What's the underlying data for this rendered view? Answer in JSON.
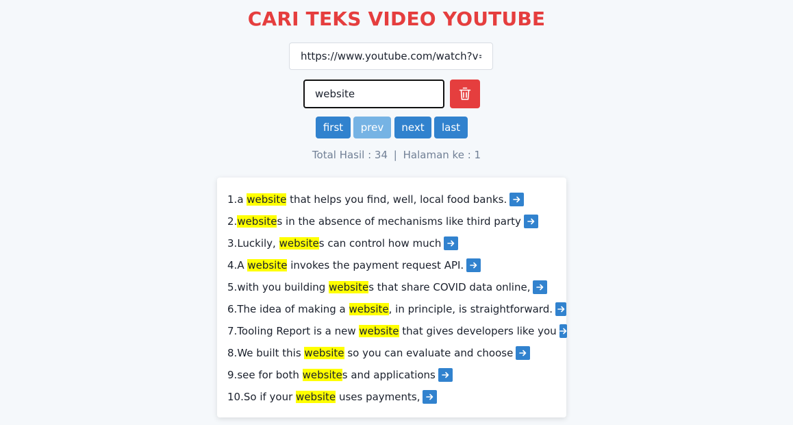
{
  "title": "CARI TEKS VIDEO YOUTUBE",
  "url_input": {
    "value": "https://www.youtube.com/watch?v=kl"
  },
  "keyword_input": {
    "value": "website"
  },
  "pagination": {
    "first": "first",
    "prev": "prev",
    "next": "next",
    "last": "last"
  },
  "status": {
    "total_text": "Total Hasil : 34",
    "separator": "|",
    "page_text": "Halaman ke : 1"
  },
  "results": [
    {
      "num": "1.",
      "before": "a ",
      "match": "website",
      "after": " that helps you find, well, local food banks."
    },
    {
      "num": "2.",
      "before": "",
      "match": "website",
      "after": "s in the absence of mechanisms like third party"
    },
    {
      "num": "3.",
      "before": "Luckily, ",
      "match": "website",
      "after": "s can control how much"
    },
    {
      "num": "4.",
      "before": "A ",
      "match": "website",
      "after": " invokes the payment request API."
    },
    {
      "num": "5.",
      "before": "with you building ",
      "match": "website",
      "after": "s that share COVID data online,"
    },
    {
      "num": "6.",
      "before": "The idea of making a ",
      "match": "website",
      "after": ", in principle, is straightforward."
    },
    {
      "num": "7.",
      "before": "Tooling Report is a new ",
      "match": "website",
      "after": " that gives developers like you"
    },
    {
      "num": "8.",
      "before": "We built this ",
      "match": "website",
      "after": " so you can evaluate and choose"
    },
    {
      "num": "9.",
      "before": "see for both ",
      "match": "website",
      "after": "s and applications"
    },
    {
      "num": "10.",
      "before": "So if your ",
      "match": "website",
      "after": " uses payments,"
    }
  ],
  "icons": {
    "delete": "trash-icon",
    "go": "arrow-right-icon"
  },
  "colors": {
    "title": "#e53e3e",
    "delete_button": "#e53e3e",
    "pager_button": "#3182ce",
    "pager_button_disabled": "#76b3e4",
    "highlight": "#ffff00",
    "status_text": "#718096",
    "background": "#f5f8fb"
  }
}
